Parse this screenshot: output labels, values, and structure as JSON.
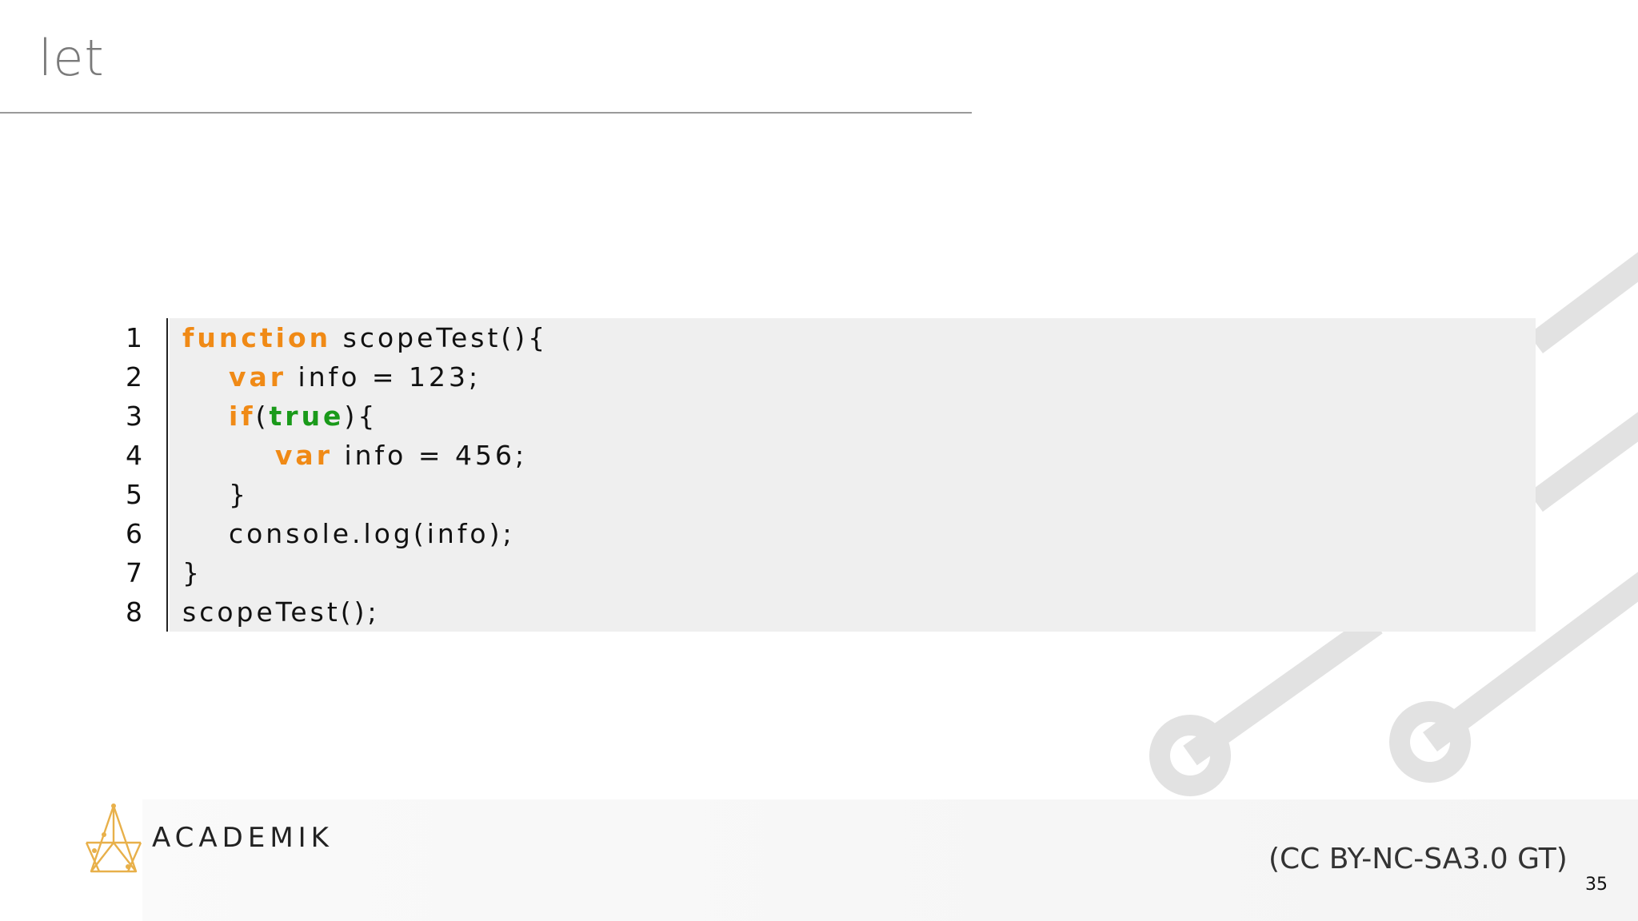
{
  "slide": {
    "title": "let",
    "page_number": "35"
  },
  "code": {
    "lines": [
      {
        "no": "1",
        "tokens": [
          {
            "t": "function",
            "c": "kw"
          },
          {
            "t": " scopeTest(){",
            "c": ""
          }
        ]
      },
      {
        "no": "2",
        "tokens": [
          {
            "t": "    ",
            "c": ""
          },
          {
            "t": "var",
            "c": "kw"
          },
          {
            "t": " info = 123;",
            "c": ""
          }
        ]
      },
      {
        "no": "3",
        "tokens": [
          {
            "t": "    ",
            "c": ""
          },
          {
            "t": "if",
            "c": "kw"
          },
          {
            "t": "(",
            "c": ""
          },
          {
            "t": "true",
            "c": "lit"
          },
          {
            "t": "){",
            "c": ""
          }
        ]
      },
      {
        "no": "4",
        "tokens": [
          {
            "t": "        ",
            "c": ""
          },
          {
            "t": "var",
            "c": "kw"
          },
          {
            "t": " info = 456;",
            "c": ""
          }
        ]
      },
      {
        "no": "5",
        "tokens": [
          {
            "t": "    }",
            "c": ""
          }
        ]
      },
      {
        "no": "6",
        "tokens": [
          {
            "t": "    console.log(info);",
            "c": ""
          }
        ]
      },
      {
        "no": "7",
        "tokens": [
          {
            "t": "}",
            "c": ""
          }
        ]
      },
      {
        "no": "8",
        "tokens": [
          {
            "t": "scopeTest();",
            "c": ""
          }
        ]
      }
    ]
  },
  "footer": {
    "brand": "ACADEMIK",
    "license": "(CC BY-NC-SA3.0 GT)"
  },
  "colors": {
    "keyword": "#f08a16",
    "literal": "#1a9a1a",
    "title": "#7a7a7a",
    "circuit": "#e3e3e3",
    "logo": "#e8b04a"
  }
}
